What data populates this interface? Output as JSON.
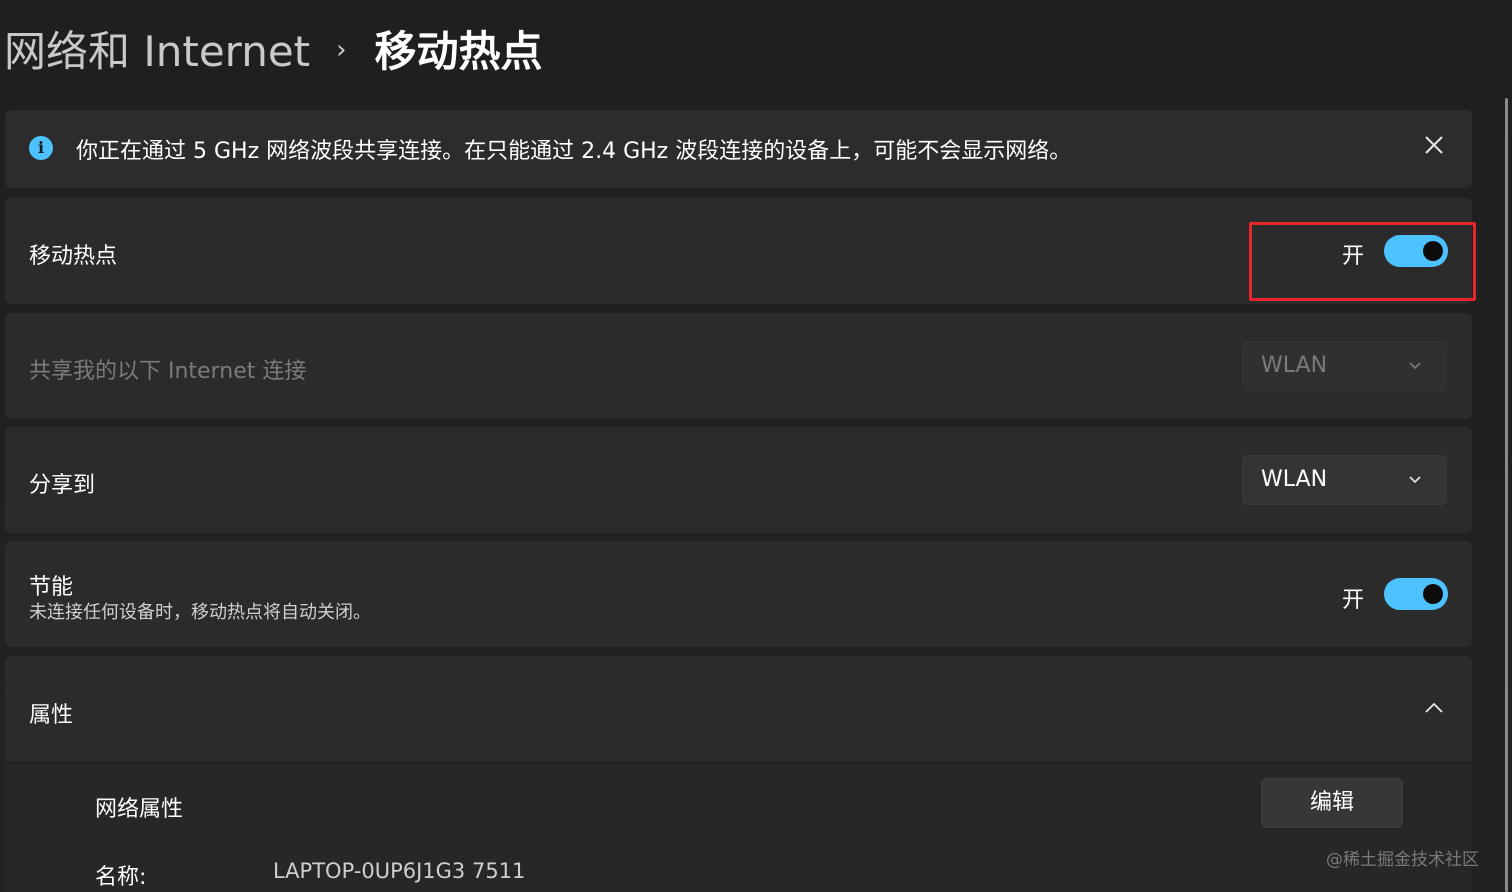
{
  "breadcrumb": {
    "parent": "网络和 Internet",
    "separator": "›",
    "current": "移动热点"
  },
  "info_bar": {
    "icon": "info-icon",
    "icon_glyph": "i",
    "message": "你正在通过 5 GHz 网络波段共享连接。在只能通过 2.4 GHz 波段连接的设备上，可能不会显示网络。",
    "close_icon": "close-icon"
  },
  "hotspot": {
    "label": "移动热点",
    "state_label": "开",
    "enabled": true
  },
  "share_from": {
    "label": "共享我的以下 Internet 连接",
    "value": "WLAN",
    "disabled": true
  },
  "share_to": {
    "label": "分享到",
    "value": "WLAN"
  },
  "power_saving": {
    "label": "节能",
    "description": "未连接任何设备时，移动热点将自动关闭。",
    "state_label": "开",
    "enabled": true
  },
  "properties": {
    "label": "属性",
    "expanded": true,
    "network_props_label": "网络属性",
    "edit_label": "编辑",
    "name_label": "名称:",
    "name_value": "LAPTOP-0UP6J1G3 7511"
  },
  "watermark": "@稀土掘金技术社区",
  "colors": {
    "background": "#202020",
    "card": "#2b2b2b",
    "accent": "#4cc2ff",
    "highlight": "#e8262b",
    "disabled_text": "#7b7b7b"
  }
}
